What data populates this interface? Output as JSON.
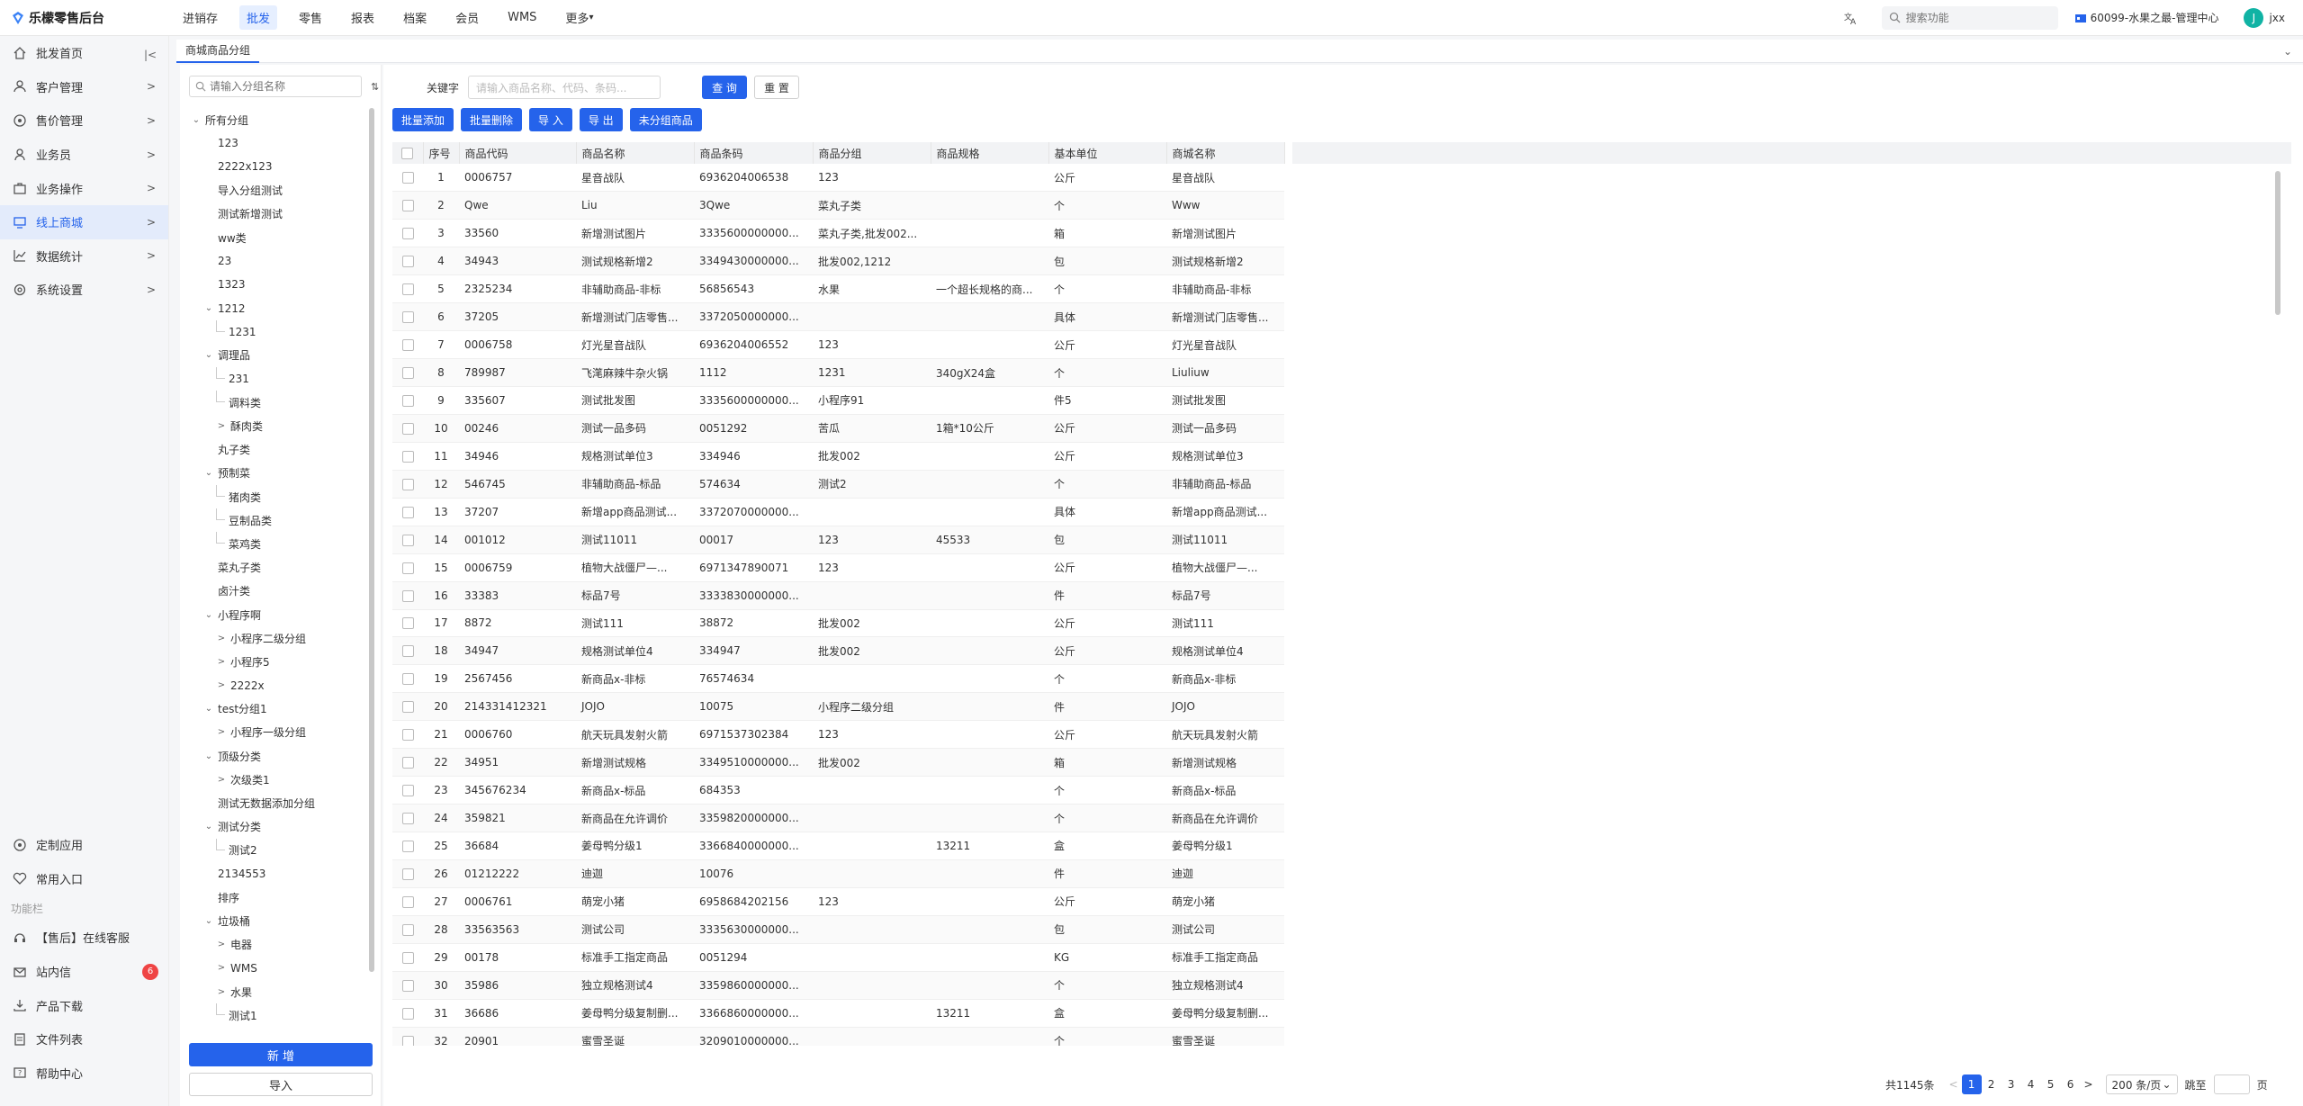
{
  "app": {
    "title": "乐檬零售后台"
  },
  "topnav": [
    "进销存",
    "批发",
    "零售",
    "报表",
    "档案",
    "会员",
    "WMS",
    "更多"
  ],
  "topnav_active": "批发",
  "search": {
    "placeholder": "搜索功能"
  },
  "store": {
    "name": "60099-水果之最-管理中心"
  },
  "user": {
    "avatar": "J",
    "name": "jxx"
  },
  "sidebar": {
    "items": [
      {
        "label": "批发首页",
        "icon": "home-icon"
      },
      {
        "label": "客户管理",
        "icon": "customer-icon"
      },
      {
        "label": "售价管理",
        "icon": "price-icon"
      },
      {
        "label": "业务员",
        "icon": "person-icon"
      },
      {
        "label": "业务操作",
        "icon": "case-icon"
      },
      {
        "label": "线上商城",
        "icon": "monitor-icon"
      },
      {
        "label": "数据统计",
        "icon": "chart-icon"
      },
      {
        "label": "系统设置",
        "icon": "gear-icon"
      }
    ],
    "active": "线上商城",
    "bottom": {
      "custom_app": "定制应用",
      "common_entry": "常用入口",
      "section_label": "功能栏",
      "service": "【售后】在线客服",
      "messages": "站内信",
      "messages_badge": "6",
      "download": "产品下载",
      "docs": "文件列表",
      "help": "帮助中心"
    }
  },
  "tab": {
    "label": "商城商品分组"
  },
  "tree": {
    "search_placeholder": "请输入分组名称",
    "nodes": [
      {
        "label": "所有分组",
        "level": 0,
        "arrow": "down"
      },
      {
        "label": "123",
        "level": 1
      },
      {
        "label": "2222x123",
        "level": 1
      },
      {
        "label": "导入分组测试",
        "level": 1
      },
      {
        "label": "测试新增测试",
        "level": 1
      },
      {
        "label": "ww类",
        "level": 1
      },
      {
        "label": "23",
        "level": 1
      },
      {
        "label": "1323",
        "level": 1
      },
      {
        "label": "1212",
        "level": 1,
        "arrow": "down"
      },
      {
        "label": "1231",
        "level": 2,
        "line": true
      },
      {
        "label": "调理品",
        "level": 1,
        "arrow": "down"
      },
      {
        "label": "231",
        "level": 2,
        "line": true
      },
      {
        "label": "调料类",
        "level": 2,
        "line": true
      },
      {
        "label": "酥肉类",
        "level": 2,
        "arrow": "right"
      },
      {
        "label": "丸子类",
        "level": 1
      },
      {
        "label": "预制菜",
        "level": 1,
        "arrow": "down"
      },
      {
        "label": "猪肉类",
        "level": 2,
        "line": true
      },
      {
        "label": "豆制品类",
        "level": 2,
        "line": true
      },
      {
        "label": "菜鸡类",
        "level": 2,
        "line": true
      },
      {
        "label": "菜丸子类",
        "level": 1
      },
      {
        "label": "卤汁类",
        "level": 1
      },
      {
        "label": "小程序啊",
        "level": 1,
        "arrow": "down"
      },
      {
        "label": "小程序二级分组",
        "level": 2,
        "arrow": "right"
      },
      {
        "label": "小程序5",
        "level": 2,
        "arrow": "right"
      },
      {
        "label": "2222x",
        "level": 2,
        "arrow": "right"
      },
      {
        "label": "test分组1",
        "level": 1,
        "arrow": "down"
      },
      {
        "label": "小程序一级分组",
        "level": 2,
        "arrow": "right"
      },
      {
        "label": "顶级分类",
        "level": 1,
        "arrow": "down"
      },
      {
        "label": "次级类1",
        "level": 2,
        "arrow": "right"
      },
      {
        "label": "测试无数据添加分组",
        "level": 1
      },
      {
        "label": "测试分类",
        "level": 1,
        "arrow": "down"
      },
      {
        "label": "测试2",
        "level": 2,
        "line": true
      },
      {
        "label": "2134553",
        "level": 1
      },
      {
        "label": "排序",
        "level": 1
      },
      {
        "label": "垃圾桶",
        "level": 1,
        "arrow": "down"
      },
      {
        "label": "电器",
        "level": 2,
        "arrow": "right"
      },
      {
        "label": "WMS",
        "level": 2,
        "arrow": "right"
      },
      {
        "label": "水果",
        "level": 2,
        "arrow": "right"
      },
      {
        "label": "测试1",
        "level": 2,
        "line": true
      }
    ],
    "new_button": "新 增",
    "import_button": "导入"
  },
  "filter": {
    "keyword_label": "关键字",
    "keyword_placeholder": "请输入商品名称、代码、条码...",
    "query_button": "查 询",
    "reset_button": "重 置"
  },
  "actions": [
    "批量添加",
    "批量删除",
    "导 入",
    "导 出",
    "未分组商品"
  ],
  "table": {
    "columns": [
      "序号",
      "商品代码",
      "商品名称",
      "商品条码",
      "商品分组",
      "商品规格",
      "基本单位",
      "商城名称"
    ],
    "rows": [
      [
        "1",
        "0006757",
        "星音战队",
        "6936204006538",
        "123",
        "",
        "公斤",
        "星音战队"
      ],
      [
        "2",
        "Qwe",
        "Liu",
        "3Qwe",
        "菜丸子类",
        "",
        "个",
        "Www"
      ],
      [
        "3",
        "33560",
        "新增测试图片",
        "3335600000000...",
        "菜丸子类,批发002...",
        "",
        "箱",
        "新增测试图片"
      ],
      [
        "4",
        "34943",
        "测试规格新增2",
        "3349430000000...",
        "批发002,1212",
        "",
        "包",
        "测试规格新增2"
      ],
      [
        "5",
        "2325234",
        "非辅助商品-非标",
        "56856543",
        "水果",
        "一个超长规格的商...",
        "个",
        "非辅助商品-非标"
      ],
      [
        "6",
        "37205",
        "新增测试门店零售...",
        "3372050000000...",
        "",
        "",
        "具体",
        "新增测试门店零售..."
      ],
      [
        "7",
        "0006758",
        "灯光星音战队",
        "6936204006552",
        "123",
        "",
        "公斤",
        "灯光星音战队"
      ],
      [
        "8",
        "789987",
        "飞滗麻辣牛杂火锅",
        "1112",
        "1231",
        "340gX24盒",
        "个",
        "Liuliuw"
      ],
      [
        "9",
        "335607",
        "测试批发图",
        "3335600000000...",
        "小程序91",
        "",
        "件5",
        "测试批发图"
      ],
      [
        "10",
        "00246",
        "测试一品多码",
        "0051292",
        "苦瓜",
        "1箱*10公斤",
        "公斤",
        "测试一品多码"
      ],
      [
        "11",
        "34946",
        "规格测试单位3",
        "334946",
        "批发002",
        "",
        "公斤",
        "规格测试单位3"
      ],
      [
        "12",
        "546745",
        "非辅助商品-标品",
        "574634",
        "测试2",
        "",
        "个",
        "非辅助商品-标品"
      ],
      [
        "13",
        "37207",
        "新增app商品测试...",
        "3372070000000...",
        "",
        "",
        "具体",
        "新增app商品测试..."
      ],
      [
        "14",
        "001012",
        "测试11011",
        "00017",
        "123",
        "45533",
        "包",
        "测试11011"
      ],
      [
        "15",
        "0006759",
        "植物大战僵尸—...",
        "6971347890071",
        "123",
        "",
        "公斤",
        "植物大战僵尸—..."
      ],
      [
        "16",
        "33383",
        "标品7号",
        "3333830000000...",
        "",
        "",
        "件",
        "标品7号"
      ],
      [
        "17",
        "8872",
        "测试111",
        "38872",
        "批发002",
        "",
        "公斤",
        "测试111"
      ],
      [
        "18",
        "34947",
        "规格测试单位4",
        "334947",
        "批发002",
        "",
        "公斤",
        "规格测试单位4"
      ],
      [
        "19",
        "2567456",
        "新商品x-非标",
        "76574634",
        "",
        "",
        "个",
        "新商品x-非标"
      ],
      [
        "20",
        "214331412321",
        "JOJO",
        "10075",
        "小程序二级分组",
        "",
        "件",
        "JOJO"
      ],
      [
        "21",
        "0006760",
        "航天玩具发射火箭",
        "6971537302384",
        "123",
        "",
        "公斤",
        "航天玩具发射火箭"
      ],
      [
        "22",
        "34951",
        "新增测试规格",
        "3349510000000...",
        "批发002",
        "",
        "箱",
        "新增测试规格"
      ],
      [
        "23",
        "345676234",
        "新商品x-标品",
        "684353",
        "",
        "",
        "个",
        "新商品x-标品"
      ],
      [
        "24",
        "359821",
        "新商品在允许调价",
        "3359820000000...",
        "",
        "",
        "个",
        "新商品在允许调价"
      ],
      [
        "25",
        "36684",
        "姜母鸭分级1",
        "3366840000000...",
        "",
        "13211",
        "盒",
        "姜母鸭分级1"
      ],
      [
        "26",
        "01212222",
        "迪迦",
        "10076",
        "",
        "",
        "件",
        "迪迦"
      ],
      [
        "27",
        "0006761",
        "萌宠小猪",
        "6958684202156",
        "123",
        "",
        "公斤",
        "萌宠小猪"
      ],
      [
        "28",
        "33563563",
        "测试公司",
        "3335630000000...",
        "",
        "",
        "包",
        "测试公司"
      ],
      [
        "29",
        "00178",
        "标准手工指定商品",
        "0051294",
        "",
        "",
        "KG",
        "标准手工指定商品"
      ],
      [
        "30",
        "35986",
        "独立规格测试4",
        "3359860000000...",
        "",
        "",
        "个",
        "独立规格测试4"
      ],
      [
        "31",
        "36686",
        "姜母鸭分级复制删...",
        "3366860000000...",
        "",
        "13211",
        "盒",
        "姜母鸭分级复制删..."
      ],
      [
        "32",
        "20901",
        "蜜雪圣诞",
        "3209010000000...",
        "",
        "",
        "个",
        "蜜雪圣诞"
      ]
    ]
  },
  "pager": {
    "total": "共1145条",
    "pages": [
      "1",
      "2",
      "3",
      "4",
      "5",
      "6"
    ],
    "current": "1",
    "size": "200 条/页",
    "jump_label": "跳至",
    "page_suffix": "页"
  }
}
